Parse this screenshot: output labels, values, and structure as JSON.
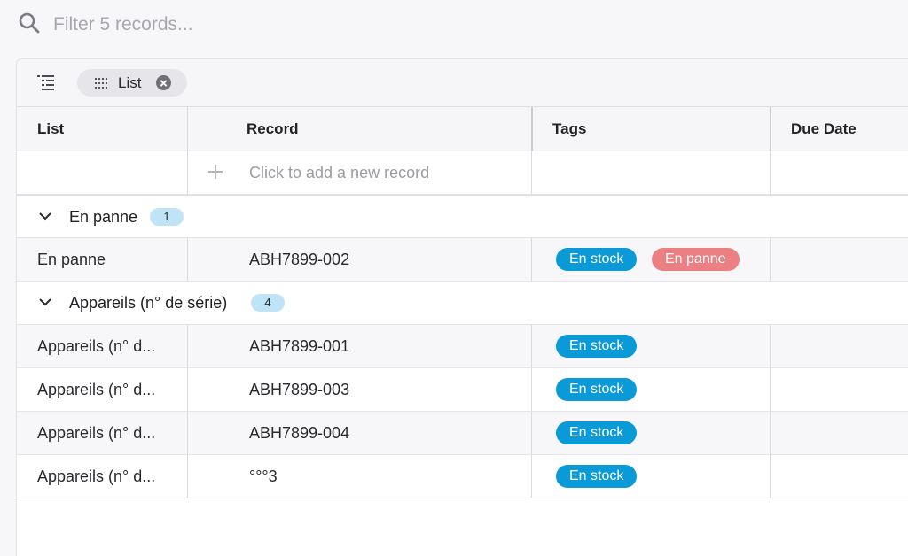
{
  "search": {
    "placeholder": "Filter 5 records..."
  },
  "toolbar": {
    "group_chip_label": "List"
  },
  "columns": {
    "list": "List",
    "record": "Record",
    "tags": "Tags",
    "due_date": "Due Date"
  },
  "add_row": {
    "label": "Click to add a new record"
  },
  "groups": [
    {
      "title": "En panne",
      "count": "1",
      "rows": [
        {
          "list": "En panne",
          "record": "ABH7899-002",
          "tags": [
            "En stock",
            "En panne"
          ]
        }
      ]
    },
    {
      "title": "Appareils (n° de série)",
      "count": "4",
      "rows": [
        {
          "list": "Appareils (n° d...",
          "record": "ABH7899-001",
          "tags": [
            "En stock"
          ]
        },
        {
          "list": "Appareils (n° d...",
          "record": "ABH7899-003",
          "tags": [
            "En stock"
          ]
        },
        {
          "list": "Appareils (n° d...",
          "record": "ABH7899-004",
          "tags": [
            "En stock"
          ]
        },
        {
          "list": "Appareils (n° d...",
          "record": "°°°3",
          "tags": [
            "En stock"
          ]
        }
      ]
    }
  ],
  "colors": {
    "tag_en_stock": "#0a9ad8",
    "tag_en_panne": "#ec7f82",
    "count_badge": "#bfe3f7"
  }
}
